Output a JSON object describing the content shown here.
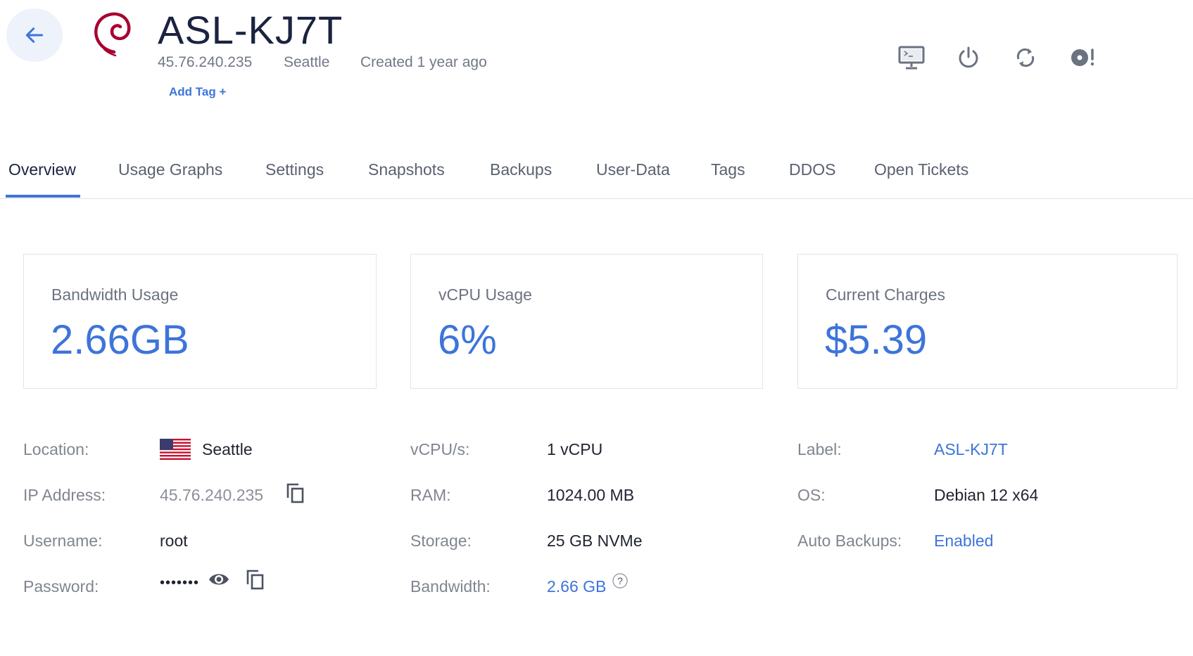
{
  "header": {
    "title": "ASL-KJ7T",
    "ip": "45.76.240.235",
    "location": "Seattle",
    "created": "Created 1 year ago",
    "add_tag": "Add Tag +"
  },
  "icons": {
    "back": "arrow-left-icon",
    "logo": "debian-logo",
    "actions": [
      "console-icon",
      "power-icon",
      "restart-icon",
      "reinstall-icon"
    ]
  },
  "tabs": [
    {
      "label": "Overview",
      "active": true
    },
    {
      "label": "Usage Graphs"
    },
    {
      "label": "Settings"
    },
    {
      "label": "Snapshots"
    },
    {
      "label": "Backups"
    },
    {
      "label": "User-Data"
    },
    {
      "label": "Tags"
    },
    {
      "label": "DDOS"
    },
    {
      "label": "Open Tickets"
    }
  ],
  "cards": [
    {
      "label": "Bandwidth Usage",
      "value": "2.66GB"
    },
    {
      "label": "vCPU Usage",
      "value": "6%"
    },
    {
      "label": "Current Charges",
      "value": "$5.39"
    }
  ],
  "details": {
    "col1": [
      {
        "label": "Location:",
        "value": "Seattle"
      },
      {
        "label": "IP Address:",
        "value": "45.76.240.235"
      },
      {
        "label": "Username:",
        "value": "root"
      },
      {
        "label": "Password:",
        "value": "•••••••"
      }
    ],
    "col2": [
      {
        "label": "vCPU/s:",
        "value": "1 vCPU"
      },
      {
        "label": "RAM:",
        "value": "1024.00 MB"
      },
      {
        "label": "Storage:",
        "value": "25 GB NVMe"
      },
      {
        "label": "Bandwidth:",
        "value": "2.66 GB"
      }
    ],
    "col3": [
      {
        "label": "Label:",
        "value": "ASL-KJ7T"
      },
      {
        "label": "OS:",
        "value": "Debian 12 x64"
      },
      {
        "label": "Auto Backups:",
        "value": "Enabled"
      }
    ]
  },
  "colors": {
    "accent": "#3d74da",
    "debian": "#a80030"
  }
}
